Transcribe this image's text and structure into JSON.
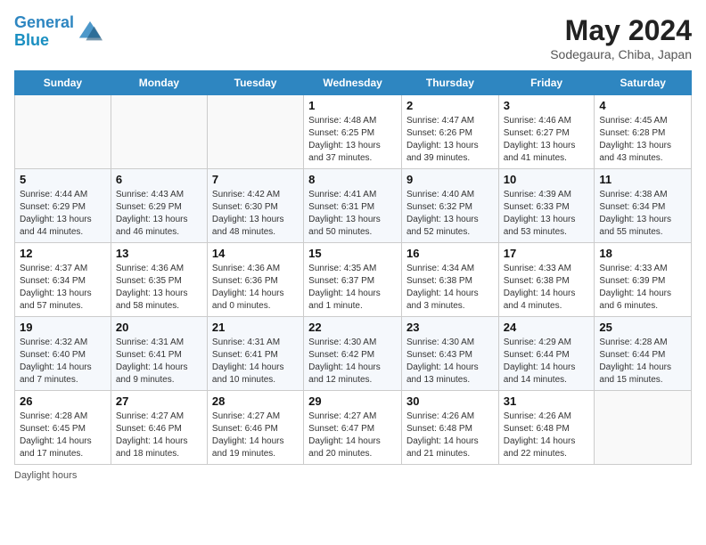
{
  "header": {
    "logo_line1": "General",
    "logo_line2": "Blue",
    "month": "May 2024",
    "location": "Sodegaura, Chiba, Japan"
  },
  "days_of_week": [
    "Sunday",
    "Monday",
    "Tuesday",
    "Wednesday",
    "Thursday",
    "Friday",
    "Saturday"
  ],
  "weeks": [
    [
      {
        "day": "",
        "info": ""
      },
      {
        "day": "",
        "info": ""
      },
      {
        "day": "",
        "info": ""
      },
      {
        "day": "1",
        "info": "Sunrise: 4:48 AM\nSunset: 6:25 PM\nDaylight: 13 hours and 37 minutes."
      },
      {
        "day": "2",
        "info": "Sunrise: 4:47 AM\nSunset: 6:26 PM\nDaylight: 13 hours and 39 minutes."
      },
      {
        "day": "3",
        "info": "Sunrise: 4:46 AM\nSunset: 6:27 PM\nDaylight: 13 hours and 41 minutes."
      },
      {
        "day": "4",
        "info": "Sunrise: 4:45 AM\nSunset: 6:28 PM\nDaylight: 13 hours and 43 minutes."
      }
    ],
    [
      {
        "day": "5",
        "info": "Sunrise: 4:44 AM\nSunset: 6:29 PM\nDaylight: 13 hours and 44 minutes."
      },
      {
        "day": "6",
        "info": "Sunrise: 4:43 AM\nSunset: 6:29 PM\nDaylight: 13 hours and 46 minutes."
      },
      {
        "day": "7",
        "info": "Sunrise: 4:42 AM\nSunset: 6:30 PM\nDaylight: 13 hours and 48 minutes."
      },
      {
        "day": "8",
        "info": "Sunrise: 4:41 AM\nSunset: 6:31 PM\nDaylight: 13 hours and 50 minutes."
      },
      {
        "day": "9",
        "info": "Sunrise: 4:40 AM\nSunset: 6:32 PM\nDaylight: 13 hours and 52 minutes."
      },
      {
        "day": "10",
        "info": "Sunrise: 4:39 AM\nSunset: 6:33 PM\nDaylight: 13 hours and 53 minutes."
      },
      {
        "day": "11",
        "info": "Sunrise: 4:38 AM\nSunset: 6:34 PM\nDaylight: 13 hours and 55 minutes."
      }
    ],
    [
      {
        "day": "12",
        "info": "Sunrise: 4:37 AM\nSunset: 6:34 PM\nDaylight: 13 hours and 57 minutes."
      },
      {
        "day": "13",
        "info": "Sunrise: 4:36 AM\nSunset: 6:35 PM\nDaylight: 13 hours and 58 minutes."
      },
      {
        "day": "14",
        "info": "Sunrise: 4:36 AM\nSunset: 6:36 PM\nDaylight: 14 hours and 0 minutes."
      },
      {
        "day": "15",
        "info": "Sunrise: 4:35 AM\nSunset: 6:37 PM\nDaylight: 14 hours and 1 minute."
      },
      {
        "day": "16",
        "info": "Sunrise: 4:34 AM\nSunset: 6:38 PM\nDaylight: 14 hours and 3 minutes."
      },
      {
        "day": "17",
        "info": "Sunrise: 4:33 AM\nSunset: 6:38 PM\nDaylight: 14 hours and 4 minutes."
      },
      {
        "day": "18",
        "info": "Sunrise: 4:33 AM\nSunset: 6:39 PM\nDaylight: 14 hours and 6 minutes."
      }
    ],
    [
      {
        "day": "19",
        "info": "Sunrise: 4:32 AM\nSunset: 6:40 PM\nDaylight: 14 hours and 7 minutes."
      },
      {
        "day": "20",
        "info": "Sunrise: 4:31 AM\nSunset: 6:41 PM\nDaylight: 14 hours and 9 minutes."
      },
      {
        "day": "21",
        "info": "Sunrise: 4:31 AM\nSunset: 6:41 PM\nDaylight: 14 hours and 10 minutes."
      },
      {
        "day": "22",
        "info": "Sunrise: 4:30 AM\nSunset: 6:42 PM\nDaylight: 14 hours and 12 minutes."
      },
      {
        "day": "23",
        "info": "Sunrise: 4:30 AM\nSunset: 6:43 PM\nDaylight: 14 hours and 13 minutes."
      },
      {
        "day": "24",
        "info": "Sunrise: 4:29 AM\nSunset: 6:44 PM\nDaylight: 14 hours and 14 minutes."
      },
      {
        "day": "25",
        "info": "Sunrise: 4:28 AM\nSunset: 6:44 PM\nDaylight: 14 hours and 15 minutes."
      }
    ],
    [
      {
        "day": "26",
        "info": "Sunrise: 4:28 AM\nSunset: 6:45 PM\nDaylight: 14 hours and 17 minutes."
      },
      {
        "day": "27",
        "info": "Sunrise: 4:27 AM\nSunset: 6:46 PM\nDaylight: 14 hours and 18 minutes."
      },
      {
        "day": "28",
        "info": "Sunrise: 4:27 AM\nSunset: 6:46 PM\nDaylight: 14 hours and 19 minutes."
      },
      {
        "day": "29",
        "info": "Sunrise: 4:27 AM\nSunset: 6:47 PM\nDaylight: 14 hours and 20 minutes."
      },
      {
        "day": "30",
        "info": "Sunrise: 4:26 AM\nSunset: 6:48 PM\nDaylight: 14 hours and 21 minutes."
      },
      {
        "day": "31",
        "info": "Sunrise: 4:26 AM\nSunset: 6:48 PM\nDaylight: 14 hours and 22 minutes."
      },
      {
        "day": "",
        "info": ""
      }
    ]
  ],
  "footer_note": "Daylight hours"
}
